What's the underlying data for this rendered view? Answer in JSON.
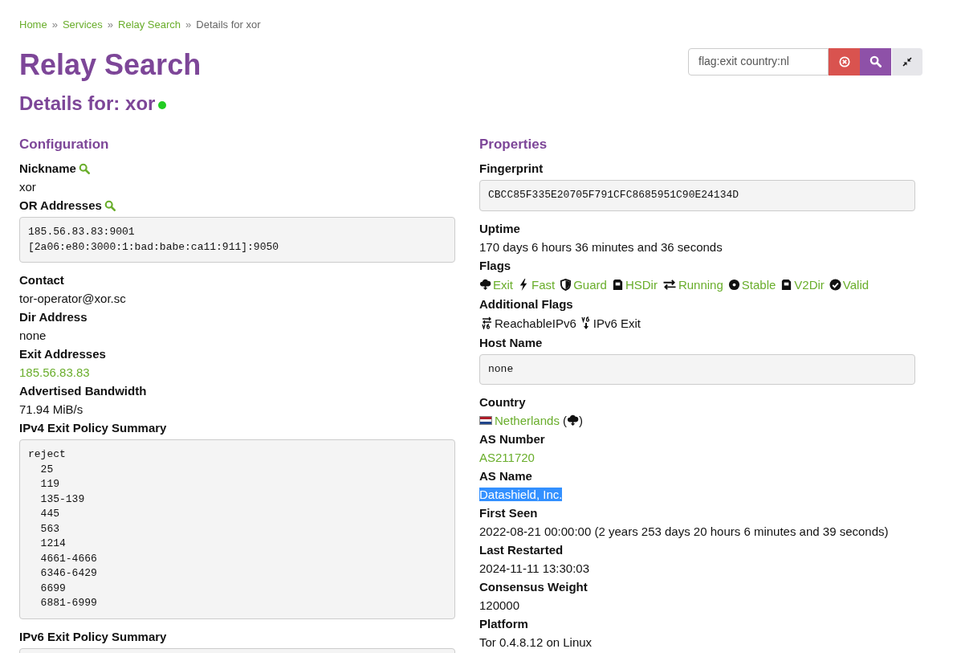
{
  "breadcrumb": [
    {
      "label": "Home",
      "link": true
    },
    {
      "label": "Services",
      "link": true
    },
    {
      "label": "Relay Search",
      "link": true
    },
    {
      "label": "Details for xor",
      "link": false
    }
  ],
  "breadcrumb_separator": "»",
  "title": "Relay Search",
  "search": {
    "value": "flag:exit country:nl"
  },
  "details": {
    "label": "Details for:",
    "name": "xor",
    "running": true
  },
  "configuration": {
    "heading": "Configuration",
    "fields": [
      {
        "label": "Nickname",
        "search_link": true,
        "kind": "text",
        "value": "xor"
      },
      {
        "label": "OR Addresses",
        "search_link": true,
        "kind": "code",
        "lines": [
          "185.56.83.83:9001",
          "[2a06:e80:3000:1:bad:babe:ca11:911]:9050"
        ]
      },
      {
        "label": "Contact",
        "search_link": false,
        "kind": "text",
        "value": "tor-operator@xor.sc"
      },
      {
        "label": "Dir Address",
        "search_link": false,
        "kind": "text",
        "value": "none"
      },
      {
        "label": "Exit Addresses",
        "search_link": false,
        "kind": "link",
        "value": "185.56.83.83"
      },
      {
        "label": "Advertised Bandwidth",
        "search_link": false,
        "kind": "text",
        "value": "71.94 MiB/s"
      },
      {
        "label": "IPv4 Exit Policy Summary",
        "search_link": false,
        "kind": "code",
        "lines": [
          "reject",
          "  25",
          "  119",
          "  135-139",
          "  445",
          "  563",
          "  1214",
          "  4661-4666",
          "  6346-6429",
          "  6699",
          "  6881-6999"
        ]
      },
      {
        "label": "IPv6 Exit Policy Summary",
        "search_link": false,
        "kind": "code_cut"
      }
    ]
  },
  "properties": {
    "heading": "Properties",
    "fields": [
      {
        "label": "Fingerprint",
        "kind": "code",
        "lines": [
          "CBCC85F335E20705F791CFC8685951C90E24134D"
        ]
      },
      {
        "label": "Uptime",
        "kind": "text",
        "value": "170 days 6 hours 36 minutes and 36 seconds"
      },
      {
        "label": "Flags",
        "kind": "flags",
        "flags": [
          {
            "kind": "exit",
            "label": "Exit"
          },
          {
            "kind": "fast",
            "label": "Fast"
          },
          {
            "kind": "guard",
            "label": "Guard"
          },
          {
            "kind": "hsdir",
            "label": "HSDir"
          },
          {
            "kind": "running",
            "label": "Running"
          },
          {
            "kind": "stable",
            "label": "Stable"
          },
          {
            "kind": "v2dir",
            "label": "V2Dir"
          },
          {
            "kind": "valid",
            "label": "Valid"
          }
        ]
      },
      {
        "label": "Additional Flags",
        "kind": "additional_flags",
        "flags": [
          {
            "kind": "reachable_ipv6",
            "label": "ReachableIPv6"
          },
          {
            "kind": "ipv6_exit",
            "label": "IPv6 Exit"
          }
        ]
      },
      {
        "label": "Host Name",
        "kind": "code",
        "lines": [
          "none"
        ]
      },
      {
        "label": "Country",
        "kind": "country",
        "value": "Netherlands",
        "open": "(",
        "close": ")"
      },
      {
        "label": "AS Number",
        "kind": "link",
        "value": "AS211720"
      },
      {
        "label": "AS Name",
        "kind": "text",
        "value": "Datashield, Inc.",
        "selected": true
      },
      {
        "label": "First Seen",
        "kind": "text",
        "value": "2022-08-21 00:00:00 (2 years 253 days 20 hours 6 minutes and 39 seconds)"
      },
      {
        "label": "Last Restarted",
        "kind": "text",
        "value": "2024-11-11 13:30:03"
      },
      {
        "label": "Consensus Weight",
        "kind": "text",
        "value": "120000"
      },
      {
        "label": "Platform",
        "kind": "text",
        "value": "Tor 0.4.8.12 on Linux"
      }
    ]
  }
}
